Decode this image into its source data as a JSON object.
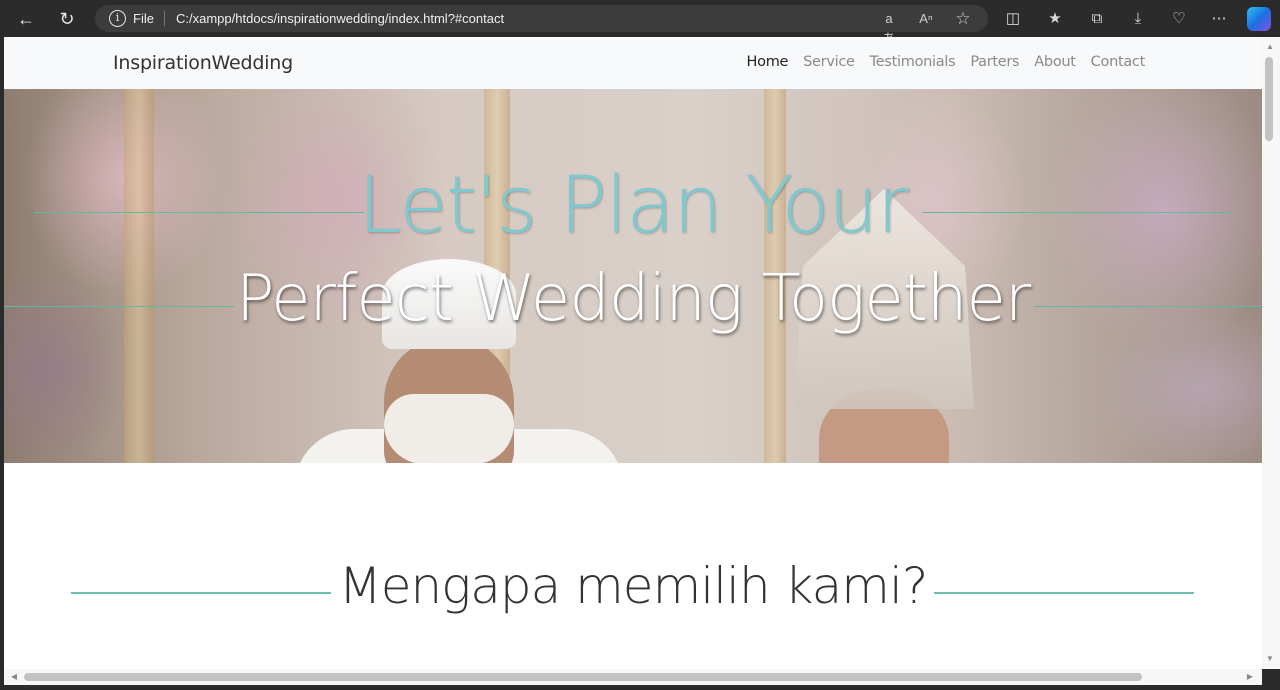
{
  "browser": {
    "file_label": "File",
    "url": "C:/xampp/htdocs/inspirationwedding/index.html?#contact",
    "translate_icon": "aあ",
    "read_aloud_icon": "A⁾"
  },
  "site": {
    "brand": "InspirationWedding",
    "nav": [
      "Home",
      "Service",
      "Testimonials",
      "Parters",
      "About",
      "Contact"
    ]
  },
  "hero": {
    "line1": "Let's Plan Your",
    "line2": "Perfect Wedding Together"
  },
  "section": {
    "heading": "Mengapa memilih kami?"
  },
  "colors": {
    "accent_line": "#5fb8a4",
    "hero_line1": "#7ec9cf",
    "active_nav": "#222222",
    "inactive_nav": "#8a8a8a"
  }
}
